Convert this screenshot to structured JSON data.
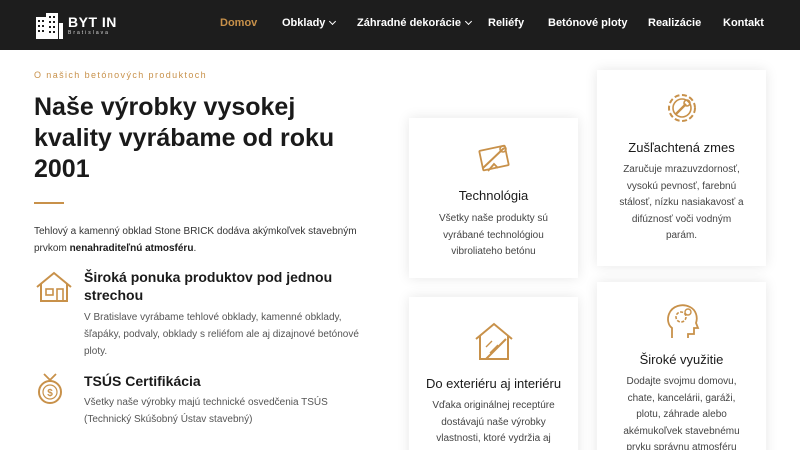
{
  "brand": {
    "name": "BYT IN",
    "sub": "Bratislava",
    "accent": "#c8914a",
    "header_bg": "#1d1d1d"
  },
  "nav": {
    "items": [
      {
        "label": "Domov",
        "active": true
      },
      {
        "label": "Obklady",
        "dropdown": true
      },
      {
        "label": "Záhradné dekorácie",
        "dropdown": true
      },
      {
        "label": "Reliéfy"
      },
      {
        "label": "Betónové ploty"
      },
      {
        "label": "Realizácie"
      },
      {
        "label": "Kontakt"
      }
    ]
  },
  "about": {
    "eyebrow": "O našich betónových produktoch",
    "headline": "Naše výrobky vysokej kvality vyrábame od roku 2001",
    "intro_text": "Tehlový a kamenný obklad Stone BRICK dodáva akýmkoľvek stavebným prvkom ",
    "intro_bold": "nenahraditeľnú atmosféru",
    "intro_end": "."
  },
  "features": [
    {
      "icon": "house-icon",
      "title": "Široká ponuka produktov pod jednou strechou",
      "text": "V Bratislave vyrábame tehlové obklady, kamenné obklady, šľapáky, podvaly, obklady s reliéfom ale aj dizajnové betónové ploty."
    },
    {
      "icon": "certificate-coin-icon",
      "title": "TSÚS Certifikácia",
      "text": "Všetky naše výrobky majú technické osvedčenia TSÚS (Technický Skúšobný Ústav stavebný)"
    }
  ],
  "cards": [
    {
      "icon": "tools-icon",
      "title": "Technológia",
      "text": "Všetky naše produkty sú vyrábané technológiou vibroliateho betónu"
    },
    {
      "icon": "gear-wrench-icon",
      "title": "Zušľachtená zmes",
      "text": "Zaručuje mrazuvzdornosť, vysokú pevnosť, farebnú stálosť, nízku nasiakavosť a difúznosť voči vodným parám."
    },
    {
      "icon": "house-plan-icon",
      "title": "Do exteriéru aj interiéru",
      "text": "Vďaka originálnej receptúre dostávajú naše výrobky vlastnosti, ktoré vydržia aj"
    },
    {
      "icon": "head-gears-icon",
      "title": "Široké využitie",
      "text": "Dodajte svojmu domovu, chate, kancelárii, garáži, plotu, záhrade alebo akémukoľvek stavebnému prvku správnu atmosféru"
    }
  ]
}
